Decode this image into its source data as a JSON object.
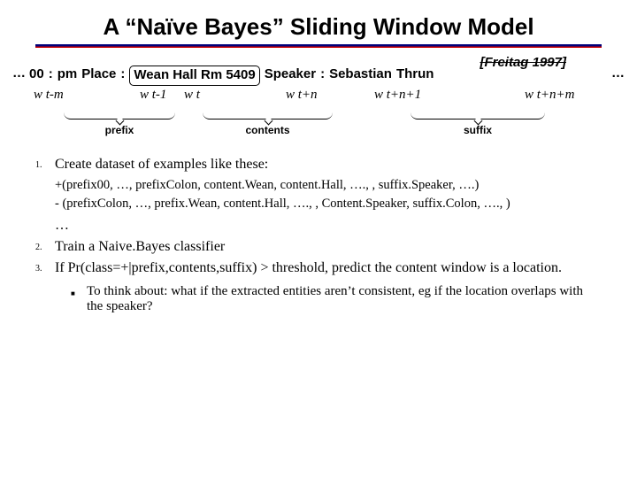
{
  "title": "A “Naïve Bayes” Sliding Window Model",
  "citation": "[Freitag 1997]",
  "ell": "…",
  "sentence": {
    "prefix": [
      "00",
      ":",
      "pm",
      "Place",
      ":"
    ],
    "boxed": [
      "Wean",
      "Hall",
      "Rm",
      "5409"
    ],
    "suffix": [
      "Speaker",
      ":",
      "Sebastian",
      "Thrun"
    ]
  },
  "w_tokens": {
    "a": "w t-m",
    "b": "w t-1",
    "c": "w t",
    "d": "w t+n",
    "e": "w t+n+1",
    "f": "w t+n+m"
  },
  "brace": {
    "prefix": "prefix",
    "contents": "contents",
    "suffix": "suffix"
  },
  "lines": {
    "l1": "Create dataset of examples like these:",
    "plus": "+(prefix00, …, prefixColon, content.Wean, content.Hall, …., , suffix.Speaker, ….)",
    "minus": "- (prefixColon, …, prefix.Wean, content.Hall, …., , Content.Speaker, suffix.Colon, …., )",
    "dots": "…",
    "l2": "Train a Naive.Bayes classifier",
    "l3": "If Pr(class=+|prefix,contents,suffix) > threshold, predict the content window is a location.",
    "bullet": "To think about: what if the extracted entities aren’t consistent, eg if the location overlaps with the speaker?"
  },
  "nums": {
    "n1": "1.",
    "n2": "2.",
    "n3": "3."
  }
}
